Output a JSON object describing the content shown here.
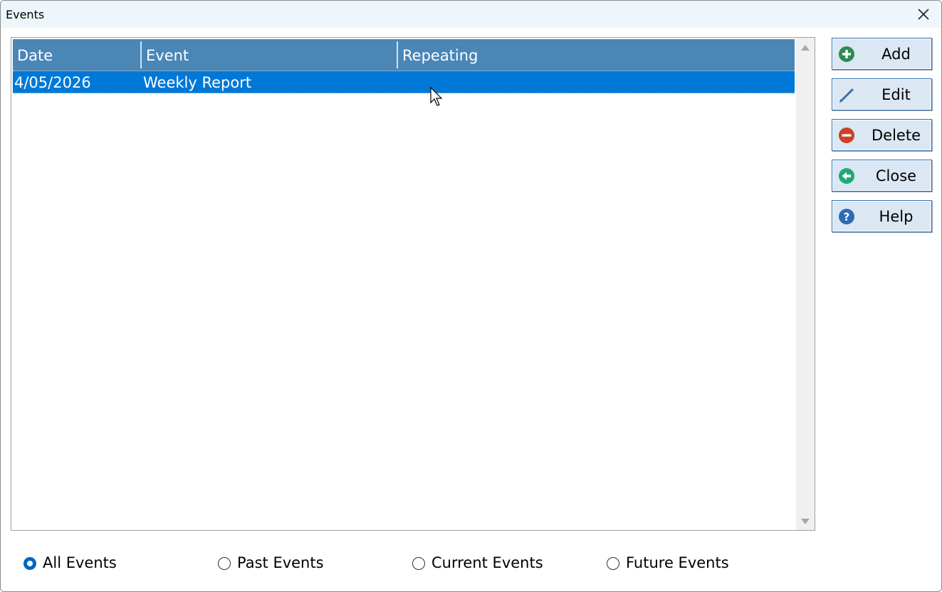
{
  "window": {
    "title": "Events"
  },
  "table": {
    "columns": [
      "Date",
      "Event",
      "Repeating"
    ],
    "rows": [
      {
        "date": "4/05/2026",
        "event": "Weekly Report",
        "repeating": "",
        "selected": true
      }
    ]
  },
  "buttons": [
    {
      "label": "Add",
      "icon": "plus-circle-icon",
      "color": "#2e8b57"
    },
    {
      "label": "Edit",
      "icon": "pencil-icon",
      "color": "#3a6ea8"
    },
    {
      "label": "Delete",
      "icon": "minus-circle-icon",
      "color": "#cc4125"
    },
    {
      "label": "Close",
      "icon": "back-arrow-circle-icon",
      "color": "#1fa87a"
    },
    {
      "label": "Help",
      "icon": "question-circle-icon",
      "color": "#2d6cb5"
    }
  ],
  "filter": {
    "options": [
      "All Events",
      "Past Events",
      "Current Events",
      "Future Events"
    ],
    "selected": "All Events"
  },
  "colors": {
    "header_bg": "#4a86b6",
    "selection_bg": "#0078d7",
    "titlebar_bg": "#eef6fb"
  }
}
